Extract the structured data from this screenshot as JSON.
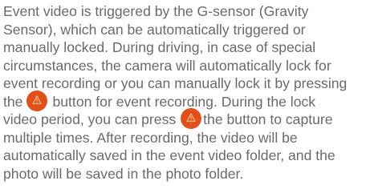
{
  "paragraph": {
    "line1": "Event video is triggered by the G-sensor (Gravity",
    "line2": "Sensor), which can be automatically triggered or",
    "line3": "manually locked. During driving, in case of special",
    "line4": "circumstances, the camera will automatically lock for",
    "line5": "event recording or you can manually lock it by pressing",
    "line6_before_button": "the",
    "line6_after_button": "button for event recording. During the lock",
    "line7_before_button": "video period, you can press",
    "line7_after_button": "the button to capture",
    "line8": "multiple times. After recording, the video will be",
    "line9": "automatically saved in the event video folder, and the",
    "line10": "photo will be saved in the photo folder."
  },
  "icons": {
    "event_lock_button": "lock-warning-icon",
    "button_color": "#e0501c"
  }
}
